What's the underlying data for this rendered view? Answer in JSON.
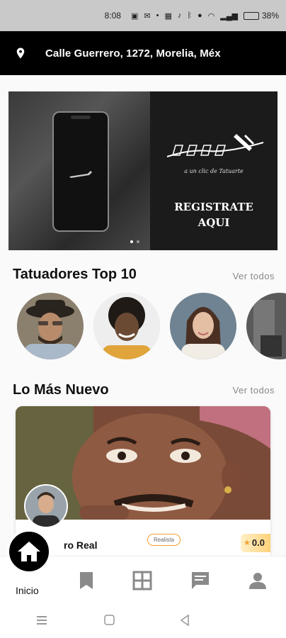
{
  "status_bar": {
    "time": "8:08",
    "battery_text": "38%",
    "battery_level": 0.38
  },
  "header": {
    "address": "Calle Guerrero, 1272, Morelia, Méx"
  },
  "banner": {
    "brand": "TATTOOAPP",
    "tagline": "a un clic de Tatuarte",
    "cta_line1": "REGISTRATE",
    "cta_line2": "AQUI",
    "slides": 2,
    "active_slide": 1
  },
  "top_tattooers": {
    "title": "Tatuadores Top 10",
    "see_all": "Ver todos"
  },
  "newest": {
    "title": "Lo Más Nuevo",
    "see_all": "Ver todos",
    "card": {
      "name": "ro Real",
      "style": "Realista",
      "rating": "0.0"
    }
  },
  "bottom_nav": {
    "home_label": "Inicio",
    "items": [
      "home-icon",
      "bookmark-icon",
      "grid-icon",
      "chat-icon",
      "profile-icon"
    ]
  },
  "colors": {
    "accent": "#f0a030",
    "header_bg": "#000000",
    "status_bg": "#c9c9c9"
  }
}
